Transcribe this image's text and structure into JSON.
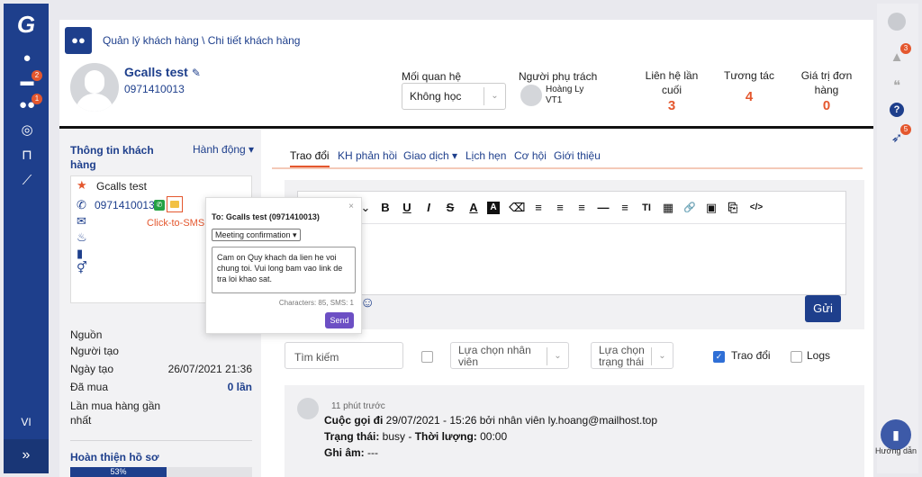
{
  "sidebar": {
    "language": "VI",
    "expand_glyph": "»",
    "badges": {
      "sales": "2",
      "customers": "1"
    },
    "icons": [
      "logo-icon",
      "user-icon",
      "briefcase-icon",
      "users-icon",
      "target-icon",
      "cart-icon",
      "chart-icon"
    ]
  },
  "rail": {
    "notification_badge": "3",
    "rocket_badge": "5",
    "help_label": "Hướng dẫn"
  },
  "header": {
    "breadcrumb": "Quản lý khách hàng \\ Chi tiết khách hàng",
    "customer_name": "Gcalls test",
    "customer_phone": "0971410013",
    "relation_label": "Mối quan hệ",
    "relation_value": "Không học",
    "owner_label": "Người phụ trách",
    "owner_name": "Hoàng Ly",
    "owner_team": "VT1",
    "stats": [
      {
        "label": "Liên hệ lần cuối",
        "value": "3"
      },
      {
        "label": "Tương tác",
        "value": "4"
      },
      {
        "label": "Giá trị đơn hàng",
        "value": "0"
      }
    ]
  },
  "info": {
    "title": "Thông tin khách hàng",
    "action": "Hành động ▾",
    "contact_name": "Gcalls test",
    "contact_phone": "0971410013",
    "click_to_sms": "Click-to-SMS",
    "fields": [
      {
        "key": "Nguồn",
        "value": ""
      },
      {
        "key": "Người tạo",
        "value": ""
      },
      {
        "key": "Ngày tạo",
        "value": "26/07/2021 21:36"
      },
      {
        "key": "Đã mua",
        "value": "0 lần"
      },
      {
        "key": "Lần mua hàng gần nhất",
        "value": ""
      }
    ],
    "profile_title": "Hoàn thiện hồ sơ",
    "profile_percent": 53,
    "profile_percent_label": "53%"
  },
  "tabs": [
    "Trao đổi",
    "KH phản hồi",
    "Giao dịch ▾",
    "Lịch hẹn",
    "Cơ hội",
    "Giới thiệu"
  ],
  "composer": {
    "send_label": "Gửi",
    "toolbar": [
      "⌄",
      "B",
      "U",
      "I",
      "S",
      "A",
      "A",
      "⌫",
      "≡",
      "≡",
      "≡",
      "—",
      "≡",
      "TI",
      "▦",
      "🔗",
      "▣",
      "⎘",
      "</>"
    ]
  },
  "filters": {
    "search_placeholder": "Tìm kiếm",
    "staff_select": "Lựa chọn nhân viên",
    "status_select": "Lựa chọn trạng thái",
    "trao_doi": "Trao đổi",
    "logs": "Logs"
  },
  "log": {
    "time": "11 phút trước",
    "call_prefix": "Cuộc gọi đi",
    "call_rest": " 29/07/2021 - 15:26 bởi nhân viên ly.hoang@mailhost.top",
    "status_label": "Trạng thái:",
    "status_value": " busy - ",
    "duration_label": "Thời lượng:",
    "duration_value": " 00:00",
    "record_label": "Ghi âm:",
    "record_value": " ---"
  },
  "sms_popup": {
    "title": "To: Gcalls test (0971410013)",
    "template": "Meeting confirmation ▾",
    "message": "Cam on Quy khach da lien he voi chung toi. Vui long bam vao link de tra loi khao sat.",
    "counter": "Characters: 85, SMS: 1",
    "send_label": "Send",
    "close": "×"
  }
}
